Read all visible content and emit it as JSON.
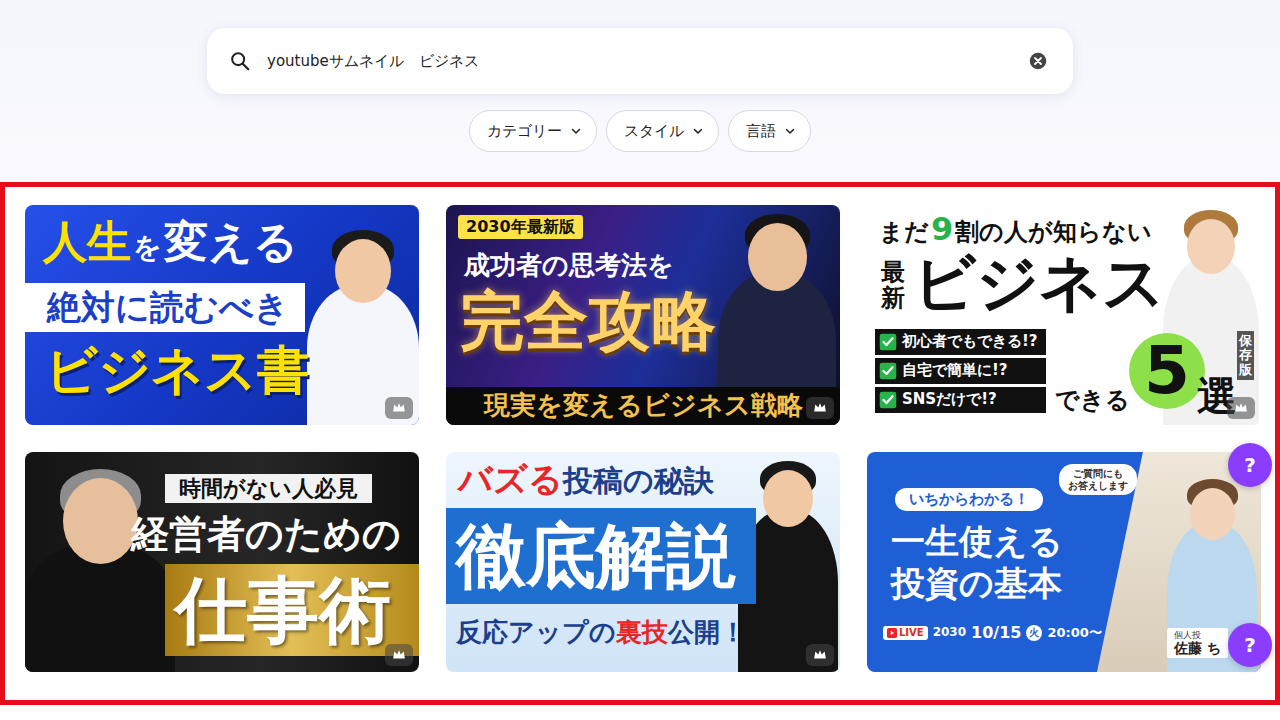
{
  "search": {
    "query": "youtubeサムネイル　ビジネス"
  },
  "filters": [
    {
      "label": "カテゴリー"
    },
    {
      "label": "スタイル"
    },
    {
      "label": "言語"
    }
  ],
  "results": [
    {
      "kind": "book",
      "premium": true,
      "lines": [
        "人生",
        "を",
        "変える",
        "絶対に読むべき",
        "ビジネス書"
      ]
    },
    {
      "kind": "strategy",
      "premium": true,
      "lines": [
        "2030年最新版",
        "成功者の思考法を",
        "完全攻略",
        "現実を変えるビジネス戦略"
      ]
    },
    {
      "kind": "list",
      "premium": true,
      "lines": [
        "まだ",
        "9",
        "割の人が知らない",
        "最新",
        "ビジネス",
        "初心者でもできる!?",
        "自宅で簡単に!?",
        "SNSだけで!?",
        "できる",
        "5",
        "選",
        "保存版"
      ]
    },
    {
      "kind": "mgmt",
      "premium": true,
      "lines": [
        "時間がない人必見",
        "経営者のための",
        "仕事術"
      ]
    },
    {
      "kind": "buzz",
      "premium": true,
      "lines": [
        "バズる",
        "投稿の秘訣",
        "徹底解説",
        "反応アップの",
        "裏技",
        "公開！"
      ]
    },
    {
      "kind": "invest",
      "premium": false,
      "lines": [
        "いちからわかる！",
        "一生使える",
        "投資の基本",
        "ご質問にも",
        "お答えします",
        "LIVE",
        "2030",
        "10/15",
        "火",
        "20:00〜",
        "個人投",
        "佐藤 ち"
      ]
    }
  ],
  "help_buttons": [
    {
      "label": "?"
    },
    {
      "label": "?"
    }
  ]
}
